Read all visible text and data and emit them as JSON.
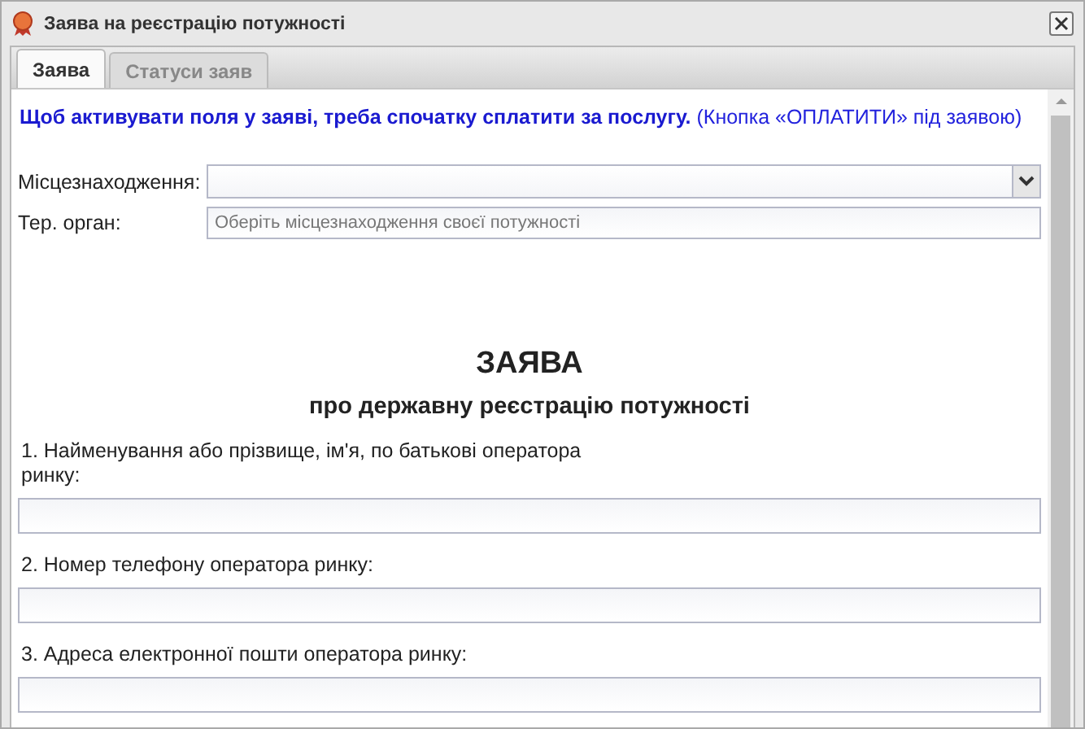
{
  "window": {
    "title": "Заява на реєстрацію потужності"
  },
  "tabs": [
    {
      "label": "Заява",
      "selected": true
    },
    {
      "label": "Статуси заяв",
      "selected": false
    }
  ],
  "notice": {
    "bold": "Щоб активувати поля у заяві, треба спочатку сплатити за послугу.",
    "hint": "(Кнопка «ОПЛАТИТИ» під заявою)"
  },
  "location_fields": [
    {
      "kind": "combo",
      "label": "Місцезнаходження:"
    },
    {
      "kind": "text",
      "label": "Тер. орган:",
      "placeholder": "Оберіть місцезнаходження своєї потужності"
    }
  ],
  "form": {
    "title": "ЗАЯВА",
    "subtitle": "про державну реєстрацію потужності",
    "questions": [
      {
        "label": "1. Найменування або прізвище, ім'я, по батькові оператора ринку:"
      },
      {
        "label": "2. Номер телефону оператора ринку:"
      },
      {
        "label": "3. Адреса електронної пошти оператора ринку:"
      }
    ]
  }
}
